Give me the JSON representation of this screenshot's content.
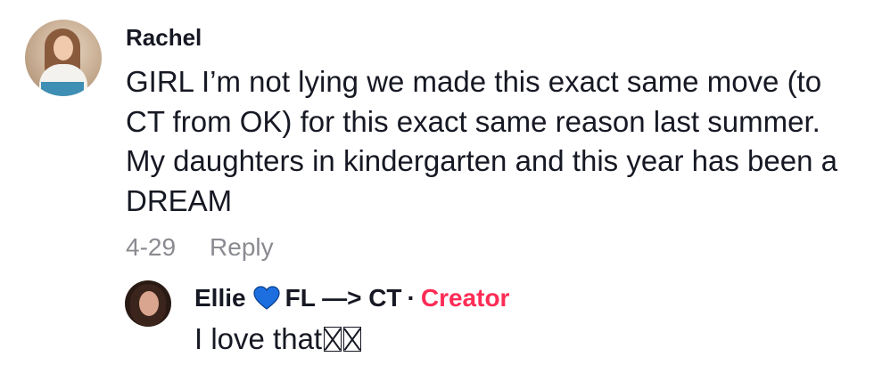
{
  "comment": {
    "username": "Rachel",
    "text": "GIRL I’m not lying we made this exact same move (to CT from OK) for this exact same reason last summer. My daughters in kindergarten and this year has been a DREAM",
    "date": "4-29",
    "reply_label": "Reply"
  },
  "reply": {
    "username_part1": "Ellie",
    "username_part2": "FL —> CT",
    "separator": "·",
    "creator_label": "Creator",
    "text": "I love that",
    "emoji_count": 2
  },
  "colors": {
    "creator": "#fe2c55",
    "heart": "#1d6fe0",
    "meta": "#8a8b91",
    "text": "#161823"
  },
  "icons": {
    "heart": "blue-heart-icon",
    "missing_emoji": "missing-glyph-box"
  }
}
